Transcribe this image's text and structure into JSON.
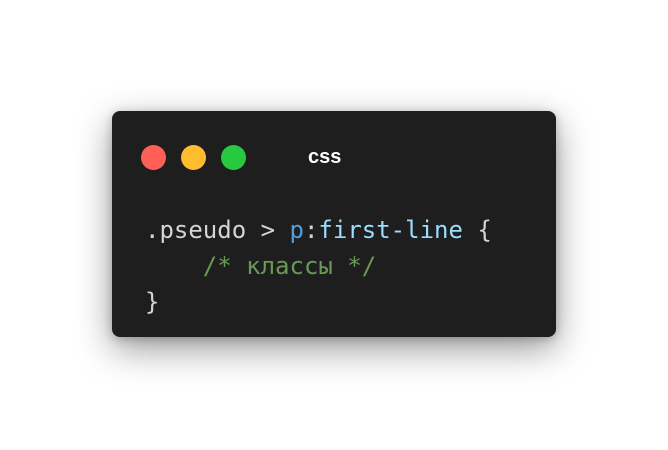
{
  "window": {
    "title": "css",
    "controls": {
      "close_color": "#ff5f56",
      "minimize_color": "#ffbd2e",
      "maximize_color": "#27c93f"
    }
  },
  "code": {
    "line1": {
      "selector": ".pseudo",
      "combinator": " > ",
      "element": "p",
      "colon": ":",
      "pseudo": "first-line",
      "brace_open": " {"
    },
    "line2": {
      "indent": "    ",
      "comment": "/* классы */"
    },
    "line3": {
      "brace_close": "}"
    }
  },
  "colors": {
    "window_bg": "#1e1e1e",
    "text_default": "#d4d4d4",
    "element": "#569cd6",
    "pseudo": "#9cdcfe",
    "comment": "#6a9955"
  }
}
